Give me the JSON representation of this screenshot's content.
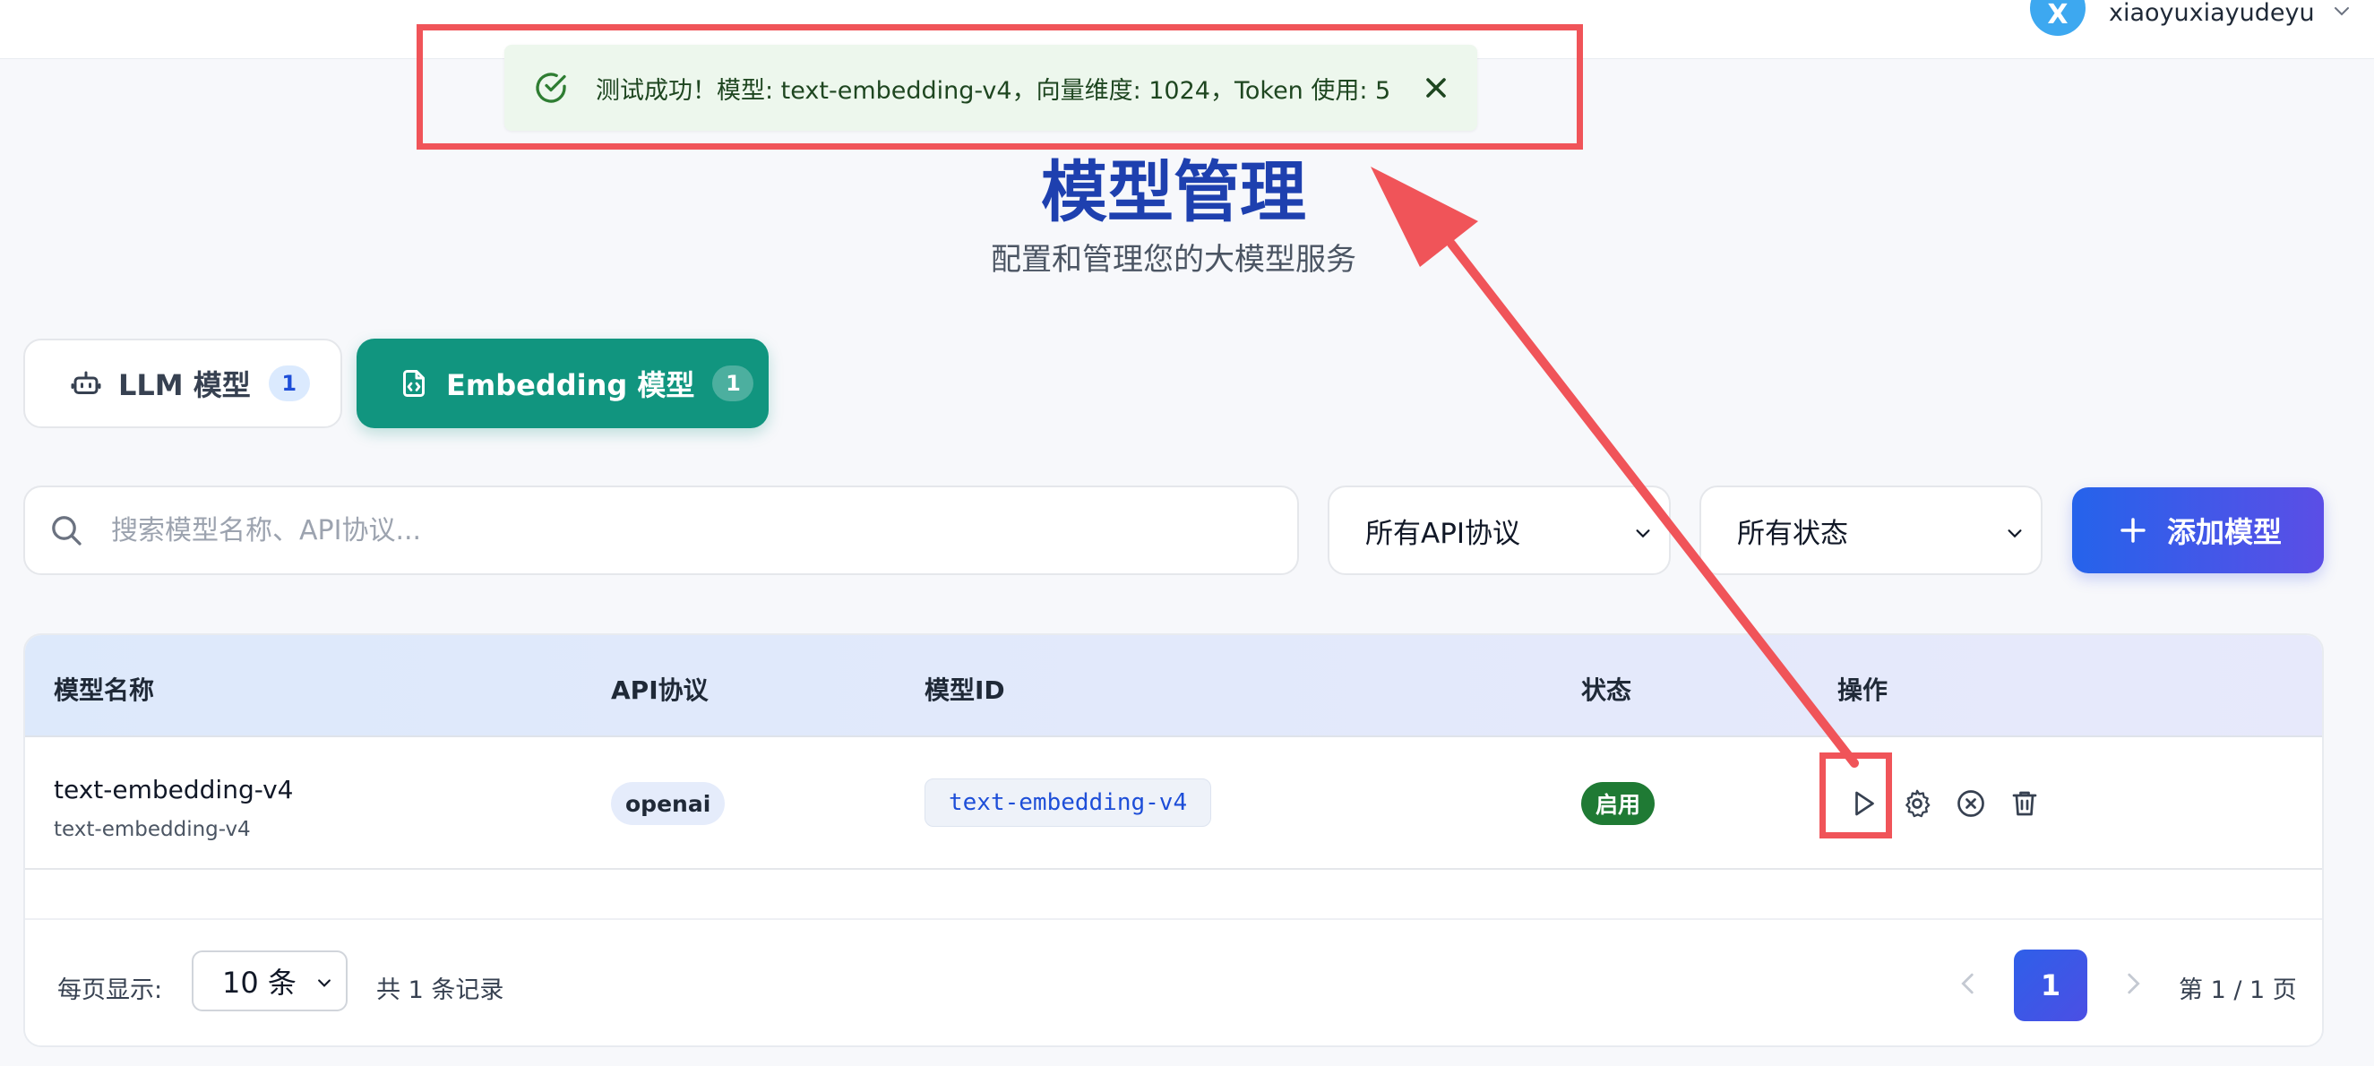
{
  "user": {
    "avatar_letter": "X",
    "username": "xiaoyuxiayudeyu"
  },
  "toast": {
    "message": "测试成功！模型: text-embedding-v4，向量维度: 1024，Token 使用: 5",
    "type": "success"
  },
  "header": {
    "title": "模型管理",
    "subtitle": "配置和管理您的大模型服务"
  },
  "tabs": [
    {
      "label": "LLM 模型",
      "count": "1",
      "active": false
    },
    {
      "label": "Embedding 模型",
      "count": "1",
      "active": true
    }
  ],
  "filters": {
    "search_placeholder": "搜索模型名称、API协议...",
    "protocol_selected": "所有API协议",
    "status_selected": "所有状态",
    "add_button_label": "添加模型"
  },
  "table": {
    "columns": [
      "模型名称",
      "API协议",
      "模型ID",
      "状态",
      "操作"
    ],
    "rows": [
      {
        "name": "text-embedding-v4",
        "name_sub": "text-embedding-v4",
        "protocol": "openai",
        "model_id": "text-embedding-v4",
        "status": "启用"
      }
    ]
  },
  "pagination": {
    "page_size_label": "每页显示:",
    "page_size_value": "10 条",
    "total_label": "共 1 条记录",
    "current_page": "1",
    "page_info": "第 1 / 1 页"
  },
  "colors": {
    "primary": "#1e40af",
    "accent_green": "#11957f",
    "status_green": "#1f7a34",
    "annotation_red": "#f05459"
  }
}
